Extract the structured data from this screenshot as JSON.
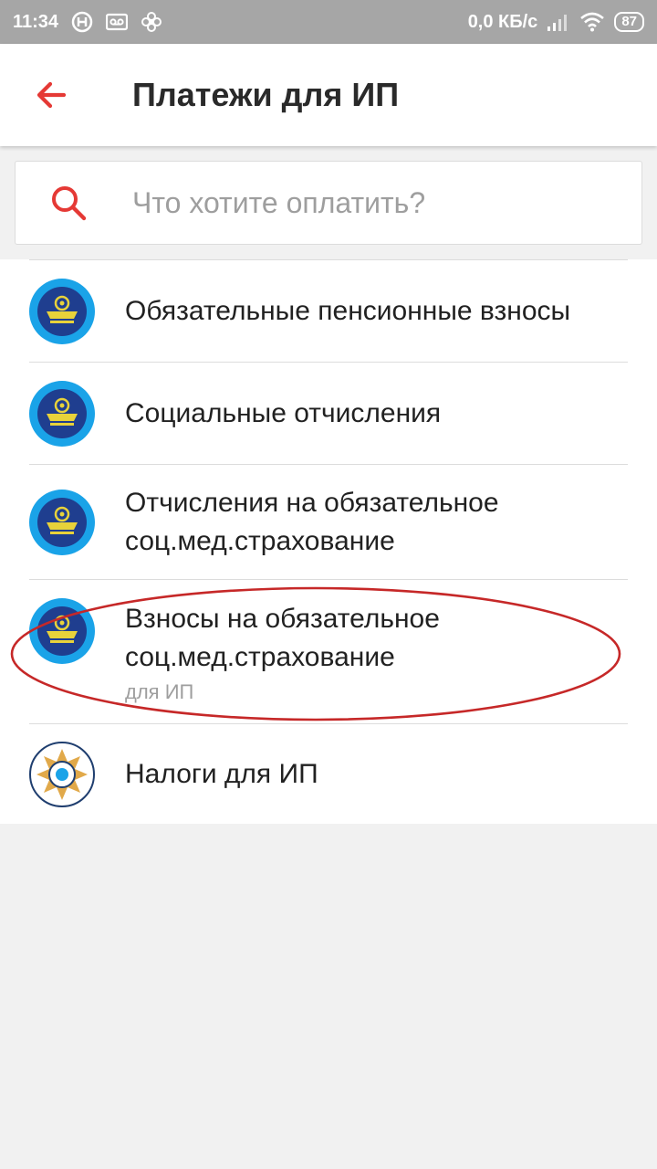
{
  "status_bar": {
    "time": "11:34",
    "network_speed": "0,0 КБ/с",
    "battery": "87",
    "icons": [
      "android-head-icon",
      "voicemail-icon",
      "pinwheel-icon",
      "signal-icon",
      "wifi-icon",
      "battery-icon"
    ]
  },
  "header": {
    "title": "Платежи для ИП",
    "back_icon": "arrow-left-icon",
    "accent_color": "#e53935"
  },
  "search": {
    "placeholder": "Что хотите оплатить?",
    "value": "",
    "icon": "search-icon"
  },
  "items": [
    {
      "title": "Обязательные пенсионные взносы",
      "subtitle": "",
      "logo": "fund-emblem-icon"
    },
    {
      "title": "Социальные отчисления",
      "subtitle": "",
      "logo": "fund-emblem-icon"
    },
    {
      "title": "Отчисления на обязательное соц.мед.страхование",
      "subtitle": "",
      "logo": "fund-emblem-icon"
    },
    {
      "title": "Взносы на обязательное соц.мед.страхование",
      "subtitle": "для ИП",
      "logo": "fund-emblem-icon"
    },
    {
      "title": "Налоги для ИП",
      "subtitle": "",
      "logo": "tax-emblem-icon"
    }
  ],
  "annotation": {
    "shape": "ellipse",
    "color": "#c62828",
    "target_item": 3
  }
}
